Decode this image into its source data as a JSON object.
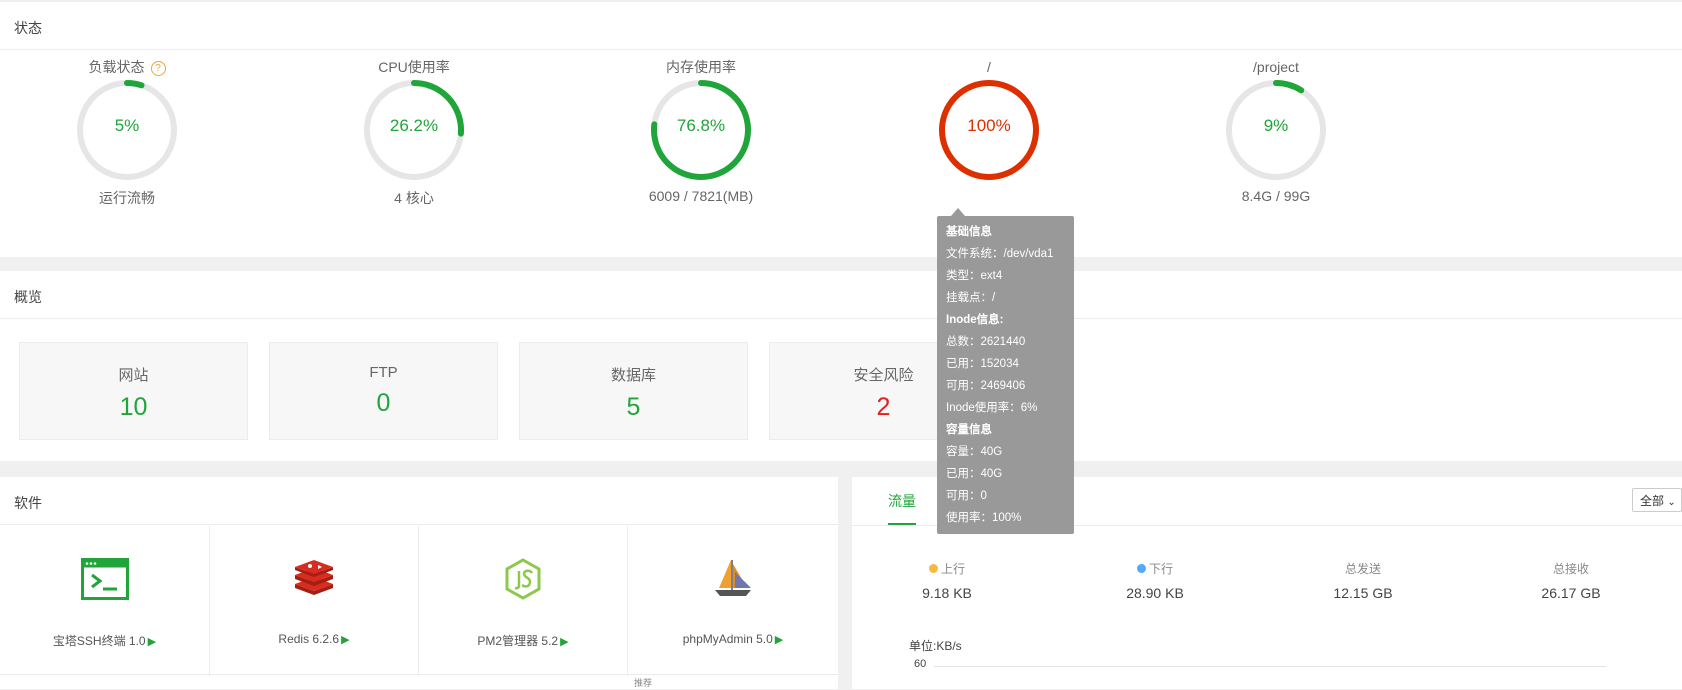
{
  "status": {
    "title": "状态",
    "gauges": [
      {
        "title": "负载状态",
        "value": "5%",
        "percent": 5,
        "sub": "运行流畅",
        "color": "#20a53a"
      },
      {
        "title": "CPU使用率",
        "value": "26.2%",
        "percent": 26.2,
        "sub": "4 核心",
        "color": "#20a53a"
      },
      {
        "title": "内存使用率",
        "value": "76.8%",
        "percent": 76.8,
        "sub": "6009 / 7821(MB)",
        "color": "#20a53a"
      },
      {
        "title": "/",
        "value": "100%",
        "percent": 100,
        "sub": "",
        "color": "#dd2f00"
      },
      {
        "title": "/project",
        "value": "9%",
        "percent": 9,
        "sub": "8.4G / 99G",
        "color": "#20a53a"
      }
    ],
    "help_icon": "?"
  },
  "overview": {
    "title": "概览",
    "cards": [
      {
        "label": "网站",
        "value": "10"
      },
      {
        "label": "FTP",
        "value": "0"
      },
      {
        "label": "数据库",
        "value": "5"
      },
      {
        "label": "安全风险",
        "value": "2"
      }
    ]
  },
  "software": {
    "title": "软件",
    "items": [
      {
        "name": "宝塔SSH终端 1.0",
        "icon": "terminal-icon"
      },
      {
        "name": "Redis 6.2.6",
        "icon": "redis-icon"
      },
      {
        "name": "PM2管理器 5.2",
        "icon": "nodejs-icon"
      },
      {
        "name": "phpMyAdmin 5.0",
        "icon": "phpmyadmin-icon"
      }
    ],
    "recommend": "推荐",
    "play": "▶"
  },
  "traffic": {
    "tab": "流量",
    "select": "全部",
    "stats": [
      {
        "label": "上行",
        "value": "9.18 KB",
        "dot": "#f7b93f"
      },
      {
        "label": "下行",
        "value": "28.90 KB",
        "dot": "#52a9ff"
      },
      {
        "label": "总发送",
        "value": "12.15 GB"
      },
      {
        "label": "总接收",
        "value": "26.17 GB"
      }
    ],
    "unit": "单位:KB/s",
    "ytick": "60"
  },
  "tooltip": {
    "lines": [
      {
        "text": "基础信息",
        "bold": true
      },
      {
        "text": "文件系统：/dev/vda1"
      },
      {
        "text": "类型：ext4"
      },
      {
        "text": "挂载点：/"
      },
      {
        "text": "Inode信息:",
        "bold": true
      },
      {
        "text": "总数：2621440"
      },
      {
        "text": "已用：152034"
      },
      {
        "text": "可用：2469406"
      },
      {
        "text": "Inode使用率：6%"
      },
      {
        "text": "容量信息",
        "bold": true
      },
      {
        "text": "容量：40G"
      },
      {
        "text": "已用：40G"
      },
      {
        "text": "可用：0"
      },
      {
        "text": "使用率：100%"
      }
    ]
  }
}
